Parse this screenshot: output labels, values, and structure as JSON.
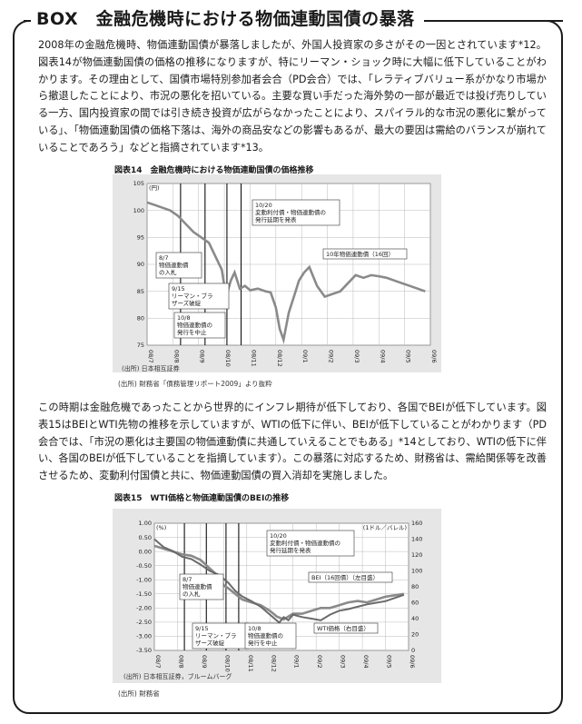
{
  "box": {
    "title": "BOX　金融危機時における物価連動国債の暴落",
    "para1": "2008年の金融危機時、物価連動国債が暴落しましたが、外国人投資家の多さがその一因とされています*12。図表14が物価連動国債の価格の推移になりますが、特にリーマン・ショック時に大幅に低下していることがわかります。その理由として、国債市場特別参加者会合（PD会合）では、「レラティブバリュー系がかなり市場から撤退したことにより、市況の悪化を招いている。主要な買い手だった海外勢の一部が最近では投げ売りしている一方、国内投資家の間では引き続き投資が広がらなかったことにより、スパイラル的な市況の悪化に繋がっている」、「物価連動国債の価格下落は、海外の商品安などの影響もあるが、最大の要因は需給のバランスが崩れていることであろう」などと指摘されています*13。",
    "para2": "この時期は金融危機であったことから世界的にインフレ期待が低下しており、各国でBEIが低下しています。図表15はBEIとWTI先物の推移を示していますが、WTIの低下に伴い、BEIが低下していることがわかります（PD会合では、「市況の悪化は主要国の物価連動債に共通していえることでもある」*14としており、WTIの低下に伴い、各国のBEIが低下していることを指摘しています）。この暴落に対応するため、財務省は、需給関係等を改善させるため、変動利付国債と共に、物価連動国債の買入消却を実施しました。",
    "fig14_title": "図表14　金融危機時における物価連動国債の価格推移",
    "fig14_source1": "(出所) 日本相互証券",
    "fig14_source2": "(出所) 財務省「債務管理リポート2009」より抜粋",
    "fig15_title": "図表15　WTI価格と物価連動国債のBEIの推移",
    "fig15_source1": "(出所) 日本相互証券，ブルームバーグ",
    "fig15_source2": "(出所) 財務省"
  },
  "chart_data": [
    {
      "type": "line",
      "title": "図表14　金融危機時における物価連動国債の価格推移",
      "ylabel": "(円)",
      "ylim": [
        75,
        105
      ],
      "yticks": [
        75,
        80,
        85,
        90,
        95,
        100,
        105
      ],
      "xticks": [
        "08/7",
        "08/8",
        "08/9",
        "08/10",
        "08/11",
        "08/12",
        "09/1",
        "09/2",
        "09/3",
        "09/4",
        "09/5",
        "09/6"
      ],
      "grid": true,
      "annotations": [
        {
          "x": 1.3,
          "text": [
            "8/7",
            "物価連動債",
            "の入札"
          ]
        },
        {
          "x": 2.25,
          "text": [
            "9/15",
            "リーマン・ブラ",
            "ザーズ破綻"
          ]
        },
        {
          "x": 3.1,
          "text": [
            "10/8",
            "物価連動債の",
            "発行を中止"
          ]
        },
        {
          "x": 3.65,
          "text": [
            "10/20",
            "変動利付債・物価連動債の",
            "発行延期を発表"
          ]
        }
      ],
      "series": [
        {
          "name": "10年物価連動債（16回）",
          "x": [
            0,
            0.3,
            0.6,
            0.9,
            1.2,
            1.5,
            1.8,
            2.1,
            2.4,
            2.7,
            2.9,
            3.0,
            3.1,
            3.25,
            3.4,
            3.6,
            3.8,
            4.0,
            4.3,
            4.6,
            4.8,
            5.0,
            5.15,
            5.3,
            5.5,
            5.7,
            5.9,
            6.1,
            6.3,
            6.6,
            6.9,
            7.2,
            7.5,
            7.8,
            8.1,
            8.4,
            8.7,
            9.0,
            9.3,
            9.6,
            9.9,
            10.2,
            10.5,
            10.8
          ],
          "y": [
            101.5,
            101,
            100.5,
            100,
            99,
            97.5,
            96,
            95,
            94,
            91,
            89,
            86,
            84.5,
            87,
            88.5,
            85.5,
            86,
            85.2,
            85.5,
            85,
            84.8,
            82,
            78,
            76,
            81,
            84,
            87,
            88.5,
            89.5,
            86,
            84,
            84.5,
            85,
            86.5,
            88,
            87.5,
            88,
            87.8,
            87.5,
            87,
            86.5,
            86,
            85.5,
            85
          ]
        }
      ]
    },
    {
      "type": "line",
      "title": "図表15　WTI価格と物価連動国債のBEIの推移",
      "ylabel": "(%)",
      "y2label": "(1ドル／バレル)",
      "ylim": [
        -3.5,
        1.0
      ],
      "y2lim": [
        0,
        160
      ],
      "yticks": [
        -3.5,
        -3.0,
        -2.5,
        -2.0,
        -1.5,
        -1.0,
        -0.5,
        0.0,
        0.5,
        1.0
      ],
      "y2ticks": [
        0,
        20,
        40,
        60,
        80,
        100,
        120,
        140,
        160
      ],
      "xticks": [
        "08/7",
        "08/8",
        "08/9",
        "08/10",
        "08/11",
        "08/12",
        "09/1",
        "09/2",
        "09/3",
        "09/4",
        "09/5",
        "09/6"
      ],
      "grid": true,
      "annotations": [
        {
          "x": 1.3,
          "text": [
            "8/7",
            "物価連動債",
            "の入札"
          ]
        },
        {
          "x": 2.25,
          "text": [
            "9/15",
            "リーマン・ブラ",
            "ザーズ破綻"
          ]
        },
        {
          "x": 3.1,
          "text": [
            "10/8",
            "物価連動債の",
            "発行を中止"
          ]
        },
        {
          "x": 3.65,
          "text": [
            "10/20",
            "変動利付債・物価連動債の",
            "発行延期を発表"
          ]
        }
      ],
      "series": [
        {
          "name": "BEI（16回債）（左目盛）",
          "axis": "left",
          "x": [
            0,
            0.4,
            0.8,
            1.2,
            1.6,
            2.0,
            2.4,
            2.8,
            3.0,
            3.2,
            3.5,
            3.8,
            4.2,
            4.6,
            5.0,
            5.3,
            5.6,
            6.0,
            6.4,
            6.8,
            7.2,
            7.6,
            8.0,
            8.4,
            8.8,
            9.2,
            9.6,
            10.0,
            10.4,
            10.8
          ],
          "y": [
            0.2,
            0.1,
            0.0,
            -0.1,
            -0.15,
            -0.3,
            -0.6,
            -0.9,
            -1.2,
            -1.3,
            -1.5,
            -1.7,
            -1.8,
            -1.9,
            -2.1,
            -2.3,
            -2.4,
            -2.2,
            -2.2,
            -2.1,
            -2.0,
            -2.0,
            -1.9,
            -1.8,
            -1.75,
            -1.8,
            -1.7,
            -1.6,
            -1.55,
            -1.5
          ]
        },
        {
          "name": "WTI価格（右目盛）",
          "axis": "right",
          "x": [
            0,
            0.4,
            0.8,
            1.2,
            1.6,
            2.0,
            2.4,
            2.8,
            3.0,
            3.2,
            3.5,
            3.8,
            4.2,
            4.6,
            5.0,
            5.2,
            5.4,
            5.6,
            5.8,
            6.0,
            6.4,
            6.8,
            7.2,
            7.6,
            8.0,
            8.4,
            8.8,
            9.2,
            9.6,
            10.0,
            10.4,
            10.8
          ],
          "y": [
            140,
            130,
            125,
            118,
            115,
            108,
            100,
            95,
            90,
            85,
            75,
            68,
            62,
            55,
            45,
            40,
            35,
            42,
            38,
            45,
            42,
            40,
            38,
            45,
            50,
            52,
            55,
            58,
            60,
            62,
            66,
            70
          ]
        }
      ]
    }
  ]
}
